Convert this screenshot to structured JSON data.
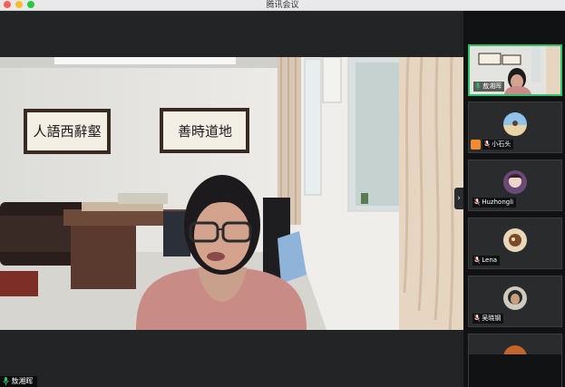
{
  "window": {
    "title": "腾讯会议"
  },
  "main": {
    "speaker_name": "敖湘晖",
    "calligraphy_left": "人語西辭壑",
    "calligraphy_right": "善時道地"
  },
  "participants": [
    {
      "name": "敖湘晖",
      "active": true
    },
    {
      "name": "小石头",
      "host": true
    },
    {
      "name": "Huzhongli"
    },
    {
      "name": "Lena"
    },
    {
      "name": "吴晓钢"
    }
  ],
  "colors": {
    "active_border": "#2ec26b",
    "host_badge": "#f08a33",
    "mic_green": "#2ec26b"
  }
}
